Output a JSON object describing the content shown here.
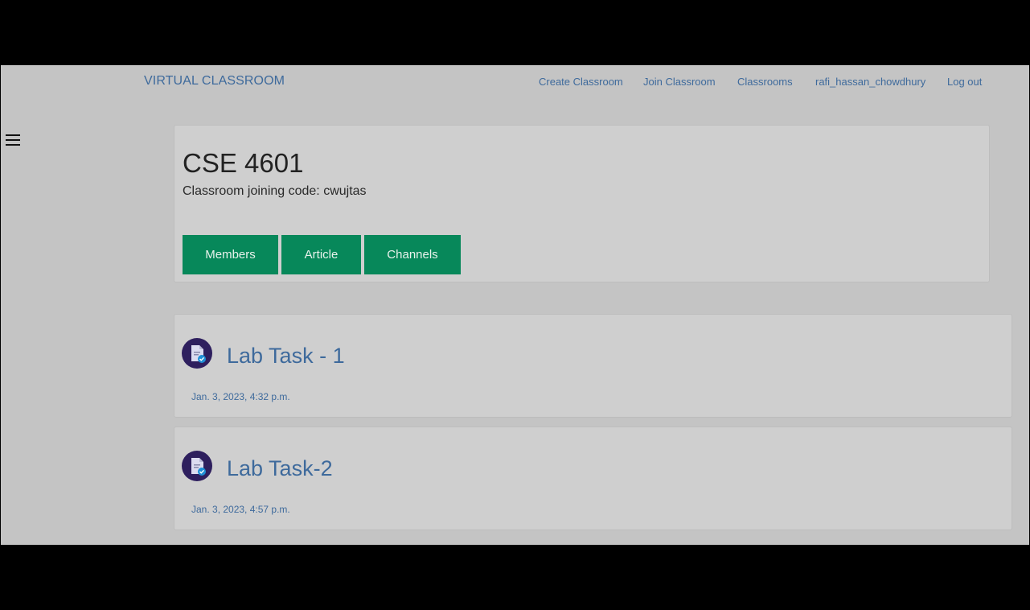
{
  "navbar": {
    "brand": "VIRTUAL CLASSROOM",
    "links": [
      "Create Classroom",
      "Join Classroom",
      "Classrooms",
      "rafi_hassan_chowdhury",
      "Log out"
    ]
  },
  "sidebar": {
    "toggle_icon": "hamburger-menu-icon"
  },
  "classroom": {
    "title": "CSE 4601",
    "join_code_line": "Classroom joining code: cwujtas",
    "buttons": [
      "Members",
      "Article",
      "Channels"
    ]
  },
  "posts": [
    {
      "title": "Lab Task - 1",
      "date": "Jan. 3, 2023, 4:32 p.m.",
      "icon": "document-check-icon"
    },
    {
      "title": "Lab Task-2",
      "date": "Jan. 3, 2023, 4:57 p.m.",
      "icon": "document-check-icon"
    }
  ],
  "colors": {
    "accent": "#07885a",
    "link": "#3e6a9c",
    "icon_bg": "#2e1f5e"
  }
}
